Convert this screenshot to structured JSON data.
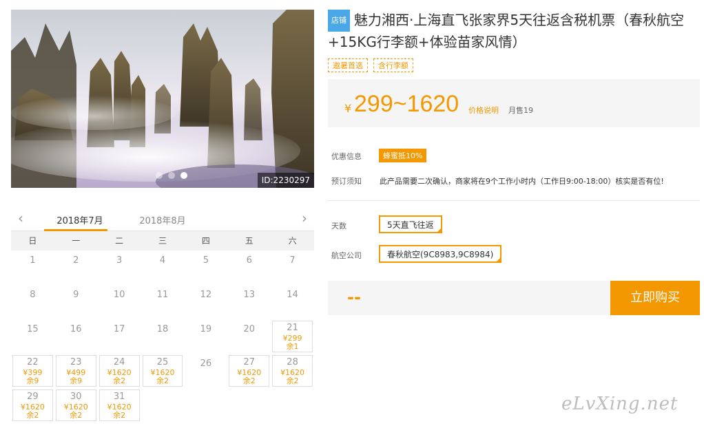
{
  "photo": {
    "id_label": "ID:2230297",
    "dots": 3,
    "active_dot": 2
  },
  "product": {
    "store_badge": "店铺",
    "title": "魅力湘西·上海直飞张家界5天往返含税机票（春秋航空+15KG行李额+体验苗家风情）",
    "tags": [
      "遨暑首选",
      "含行李额"
    ]
  },
  "price": {
    "currency": "¥",
    "range": "299~1620",
    "explain_link": "价格说明",
    "monthly_sales": "月售19"
  },
  "promotion": {
    "label": "优惠信息",
    "badge": "蜂蜜抵10%"
  },
  "booking_notice": {
    "label": "预订须知",
    "text": "此产品需要二次确认，商家将在9个工作小时内（工作日9:00-18:00）核实是否有位!"
  },
  "options": {
    "days_label": "天数",
    "days_value": "5天直飞往返",
    "airline_label": "航空公司",
    "airline_value": "春秋航空(9C8983,9C8984)"
  },
  "buy": {
    "total": "--",
    "button": "立即购买"
  },
  "calendar": {
    "months": [
      "2018年7月",
      "2018年8月"
    ],
    "active_month": 0,
    "weekdays": [
      "日",
      "一",
      "二",
      "三",
      "四",
      "五",
      "六"
    ],
    "weeks": [
      [
        {
          "d": "1"
        },
        {
          "d": "2"
        },
        {
          "d": "3"
        },
        {
          "d": "4"
        },
        {
          "d": "5"
        },
        {
          "d": "6"
        },
        {
          "d": "7"
        }
      ],
      [
        {
          "d": "8"
        },
        {
          "d": "9"
        },
        {
          "d": "10"
        },
        {
          "d": "11"
        },
        {
          "d": "12"
        },
        {
          "d": "13"
        },
        {
          "d": "14"
        }
      ],
      [
        {
          "d": "15"
        },
        {
          "d": "16"
        },
        {
          "d": "17"
        },
        {
          "d": "18"
        },
        {
          "d": "19"
        },
        {
          "d": "20"
        },
        {
          "d": "21",
          "p": "¥299",
          "s": "余1"
        }
      ],
      [
        {
          "d": "22",
          "p": "¥399",
          "s": "余9"
        },
        {
          "d": "23",
          "p": "¥499",
          "s": "余9"
        },
        {
          "d": "24",
          "p": "¥1620",
          "s": "余2"
        },
        {
          "d": "25",
          "p": "¥1620",
          "s": "余2"
        },
        {
          "d": "26"
        },
        {
          "d": "27",
          "p": "¥1620",
          "s": "余2"
        },
        {
          "d": "28",
          "p": "¥1620",
          "s": "余2"
        }
      ],
      [
        {
          "d": "29",
          "p": "¥1620",
          "s": "余2"
        },
        {
          "d": "30",
          "p": "¥1620",
          "s": "余2"
        },
        {
          "d": "31",
          "p": "¥1620",
          "s": "余2"
        },
        null,
        null,
        null,
        null
      ]
    ]
  },
  "watermark": "eLvXing.net",
  "colors": {
    "accent": "#f39800",
    "store_badge": "#4aa8e8",
    "panel_bg": "#f5f5f5"
  }
}
